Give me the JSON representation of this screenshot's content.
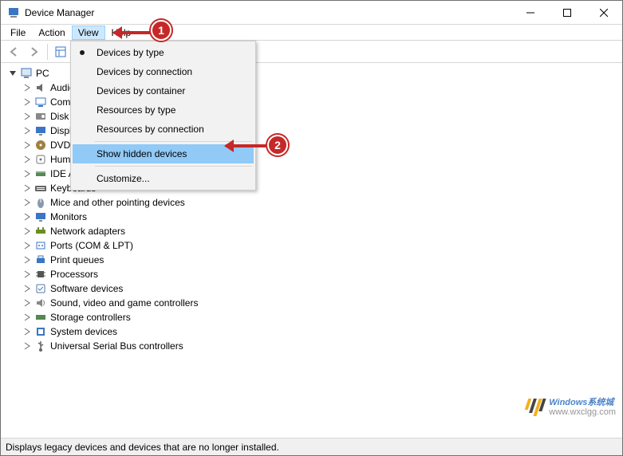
{
  "window": {
    "title": "Device Manager"
  },
  "menubar": {
    "file": "File",
    "action": "Action",
    "view": "View",
    "help": "Help"
  },
  "dropdown": {
    "devices_by_type": "Devices by type",
    "devices_by_connection": "Devices by connection",
    "devices_by_container": "Devices by container",
    "resources_by_type": "Resources by type",
    "resources_by_connection": "Resources by connection",
    "show_hidden": "Show hidden devices",
    "customize": "Customize..."
  },
  "callouts": {
    "one": "1",
    "two": "2"
  },
  "tree": {
    "root": "PC",
    "items": [
      {
        "label": "Audio inputs and outputs",
        "icon": "audio"
      },
      {
        "label": "Computer",
        "icon": "computer"
      },
      {
        "label": "Disk drives",
        "icon": "disk"
      },
      {
        "label": "Display adapters",
        "icon": "display"
      },
      {
        "label": "DVD/CD-ROM drives",
        "icon": "dvd"
      },
      {
        "label": "Human Interface Devices",
        "icon": "hid"
      },
      {
        "label": "IDE ATA/ATAPI controllers",
        "icon": "ide"
      },
      {
        "label": "Keyboards",
        "icon": "keyboard"
      },
      {
        "label": "Mice and other pointing devices",
        "icon": "mouse"
      },
      {
        "label": "Monitors",
        "icon": "monitor"
      },
      {
        "label": "Network adapters",
        "icon": "network"
      },
      {
        "label": "Ports (COM & LPT)",
        "icon": "ports"
      },
      {
        "label": "Print queues",
        "icon": "print"
      },
      {
        "label": "Processors",
        "icon": "cpu"
      },
      {
        "label": "Software devices",
        "icon": "software"
      },
      {
        "label": "Sound, video and game controllers",
        "icon": "sound"
      },
      {
        "label": "Storage controllers",
        "icon": "storage"
      },
      {
        "label": "System devices",
        "icon": "system"
      },
      {
        "label": "Universal Serial Bus controllers",
        "icon": "usb"
      }
    ]
  },
  "statusbar": {
    "text": "Displays legacy devices and devices that are no longer installed."
  },
  "watermark": {
    "line1": "Windows系统城",
    "line2": "www.wxclgg.com"
  },
  "icon_colors": {
    "audio": "#6b6b6b",
    "computer": "#3a76c4",
    "disk": "#888888",
    "display": "#3a76c4",
    "dvd": "#a08040",
    "hid": "#777777",
    "ide": "#558855",
    "keyboard": "#666666",
    "mouse": "#8899aa",
    "monitor": "#3a76c4",
    "network": "#6b8e23",
    "ports": "#3a76c4",
    "print": "#3a76c4",
    "cpu": "#555555",
    "software": "#5577aa",
    "sound": "#888888",
    "storage": "#558855",
    "system": "#3a76c4",
    "usb": "#666666"
  }
}
